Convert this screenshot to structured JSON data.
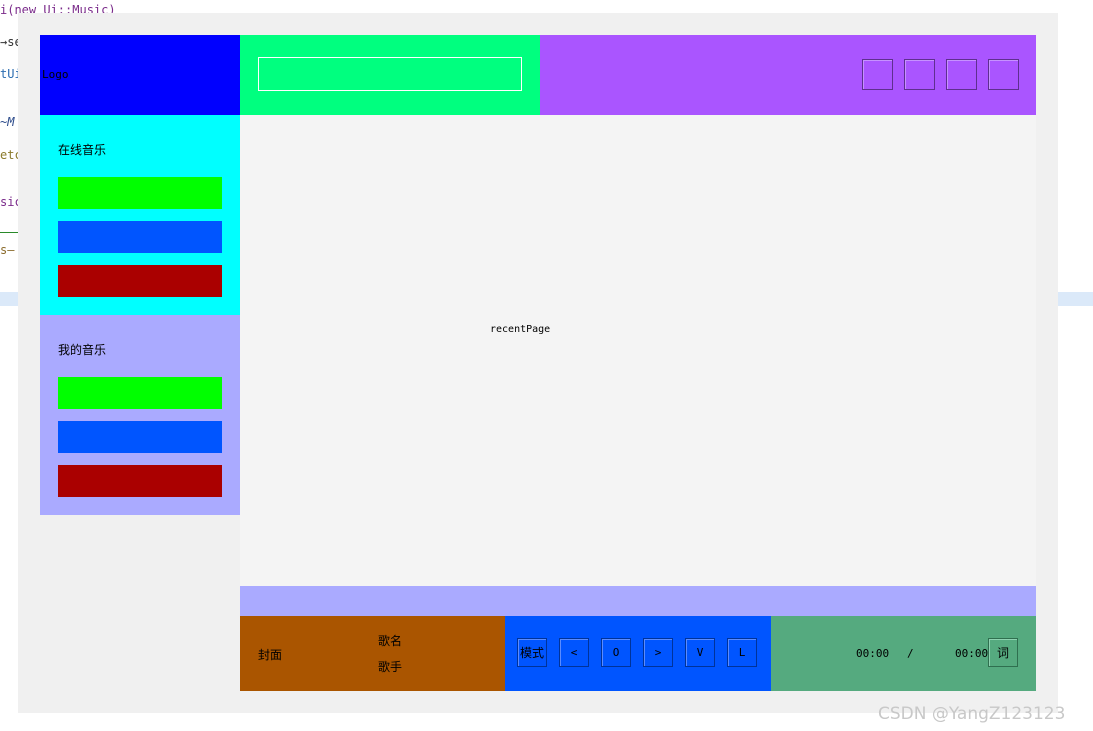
{
  "background_code": {
    "lines": [
      {
        "text": "i(new Ui::Music)",
        "color": "#7a2a8a"
      },
      {
        "text": "→se",
        "color": "#333333"
      },
      {
        "text": "tUi",
        "color": "#2b6cb0"
      },
      {
        "text": "~M",
        "color": "#2b4a8a"
      },
      {
        "text": "etc",
        "color": "#8a7a2a"
      },
      {
        "text": "sic",
        "color": "#7a2a8a"
      },
      {
        "text": "s—",
        "color": "#8a6a2a"
      }
    ]
  },
  "window": {
    "logo": {
      "label": "Logo",
      "color": "#0000ff"
    },
    "search": {
      "value": "",
      "placeholder": "",
      "area_color": "#00ff7f"
    },
    "title_bar": {
      "color": "#aa55ff",
      "buttons": [
        "square-button-1",
        "square-button-2",
        "square-button-3",
        "square-button-4"
      ]
    },
    "online_music": {
      "title": "在线音乐",
      "bg_color": "#00ffff",
      "items": [
        {
          "color": "#00ff00"
        },
        {
          "color": "#0055ff"
        },
        {
          "color": "#aa0000"
        }
      ]
    },
    "my_music": {
      "title": "我的音乐",
      "bg_color": "#aaaaff",
      "items": [
        {
          "color": "#00ff00"
        },
        {
          "color": "#0055ff"
        },
        {
          "color": "#aa0000"
        }
      ]
    },
    "content": {
      "page_label": "recentPage"
    },
    "player": {
      "cover_label": "封面",
      "song_name": "歌名",
      "singer": "歌手",
      "controls": {
        "mode": "模式",
        "prev": "<",
        "play": "O",
        "next": ">",
        "volume": "V",
        "list": "L"
      },
      "current_time": "00:00",
      "separator": "/",
      "total_time": "00:00",
      "lyric_label": "词"
    }
  },
  "watermark": "CSDN @YangZ123123"
}
